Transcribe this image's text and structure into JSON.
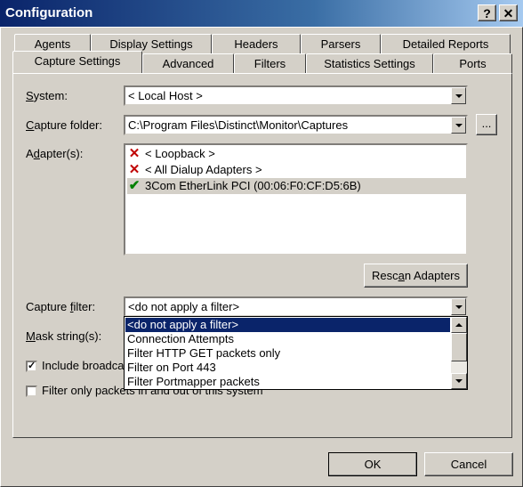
{
  "window": {
    "title": "Configuration",
    "help_glyph": "?",
    "close_glyph": "✕"
  },
  "tabs_back": [
    "Agents",
    "Display Settings",
    "Headers",
    "Parsers",
    "Detailed Reports"
  ],
  "tabs_front": [
    "Capture Settings",
    "Advanced",
    "Filters",
    "Statistics Settings",
    "Ports"
  ],
  "active_tab": "Capture Settings",
  "system": {
    "label_u": "S",
    "label_rest": "ystem:",
    "value": "< Local Host >"
  },
  "capture_folder": {
    "label_u": "C",
    "label_rest": "apture folder:",
    "value": "C:\\Program Files\\Distinct\\Monitor\\Captures",
    "browse_label": "..."
  },
  "adapters": {
    "label_pre": "A",
    "label_u": "d",
    "label_rest": "apter(s):",
    "items": [
      {
        "text": "< Loopback >",
        "status": "disabled",
        "icon": "✕"
      },
      {
        "text": "< All Dialup Adapters >",
        "status": "disabled",
        "icon": "✕"
      },
      {
        "text": "3Com EtherLink PCI (00:06:F0:CF:D5:6B)",
        "status": "enabled",
        "icon": "✔"
      }
    ],
    "rescan_pre": "Resc",
    "rescan_u": "a",
    "rescan_rest": "n Adapters"
  },
  "capture_filter": {
    "label_pre": "Capture ",
    "label_u": "f",
    "label_rest": "ilter:",
    "value": "<do not apply a filter>",
    "options": [
      "<do not apply a filter>",
      "Connection Attempts",
      "Filter HTTP GET packets only",
      "Filter on Port 443",
      "Filter Portmapper packets"
    ],
    "selected_index": 0
  },
  "mask_string": {
    "label_u": "M",
    "label_rest": "ask string(s):"
  },
  "include_broadcast": {
    "label": "Include broadca",
    "checked": true,
    "check_glyph": "✓"
  },
  "filter_only": {
    "label": "Filter only packets in and out of this system",
    "checked": false
  },
  "buttons": {
    "ok": "OK",
    "cancel": "Cancel"
  },
  "colors": {
    "titlebar": "#0a246a",
    "selection": "#0a246a",
    "red_x": "#c00000",
    "green_check": "#008000",
    "face": "#d4d0c8"
  }
}
